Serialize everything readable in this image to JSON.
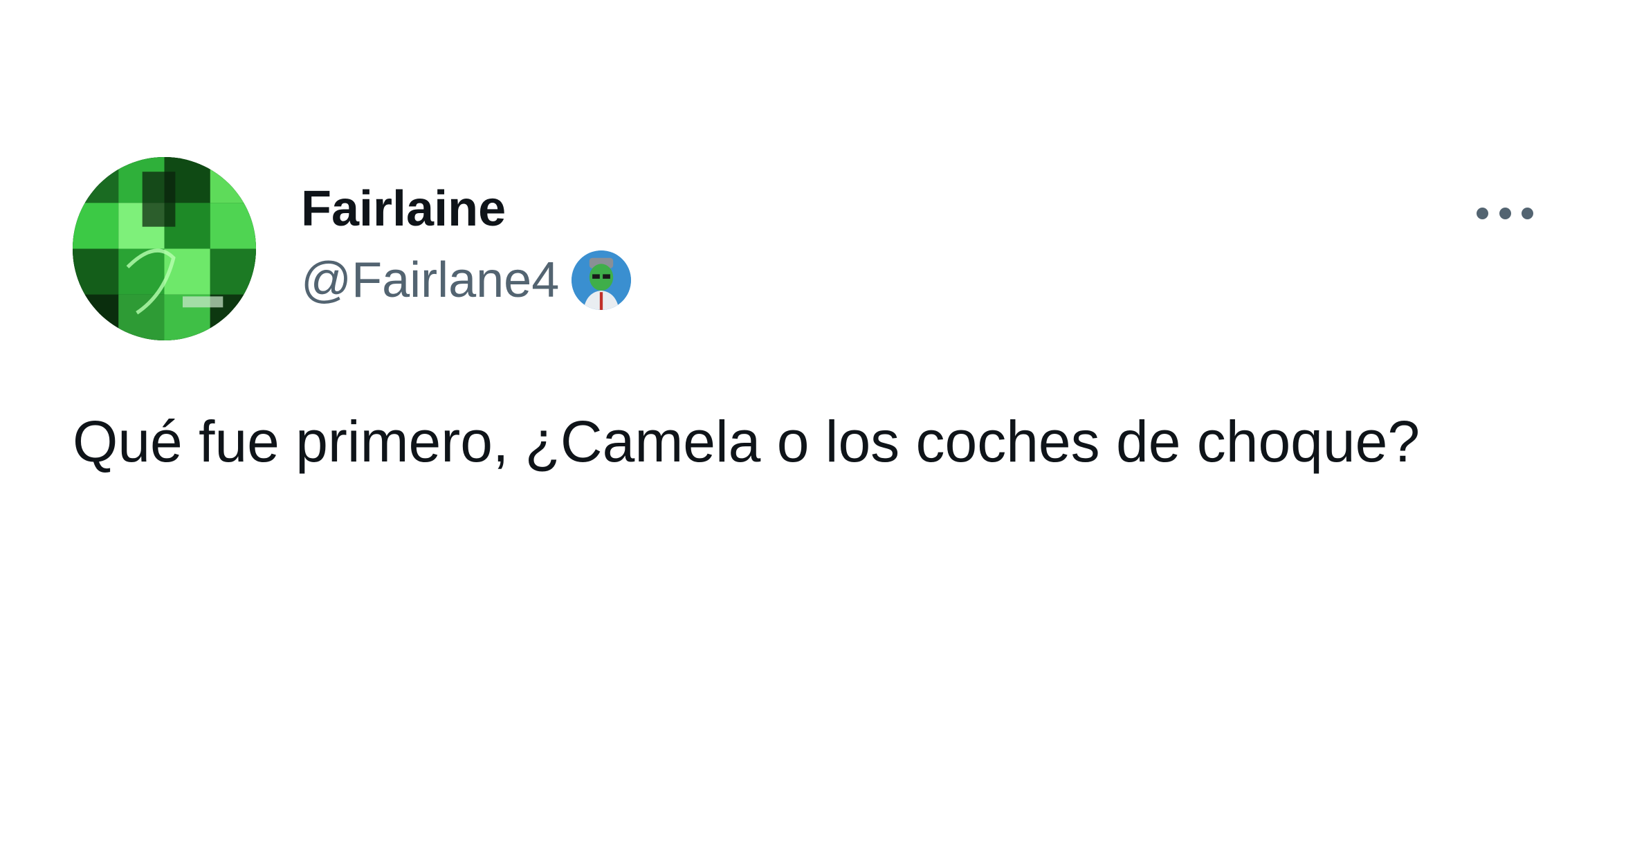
{
  "author": {
    "display_name": "Fairlaine",
    "handle": "@Fairlane4",
    "avatar_icon": "green-pixelated-avatar-icon",
    "badge_icon": "affiliate-badge-icon"
  },
  "menu": {
    "more_icon": "more-horizontal-icon"
  },
  "tweet": {
    "text": "Qué fue primero, ¿Camela o los coches de choque?"
  },
  "colors": {
    "text_primary": "#0f1419",
    "text_secondary": "#536471",
    "background": "#ffffff"
  }
}
